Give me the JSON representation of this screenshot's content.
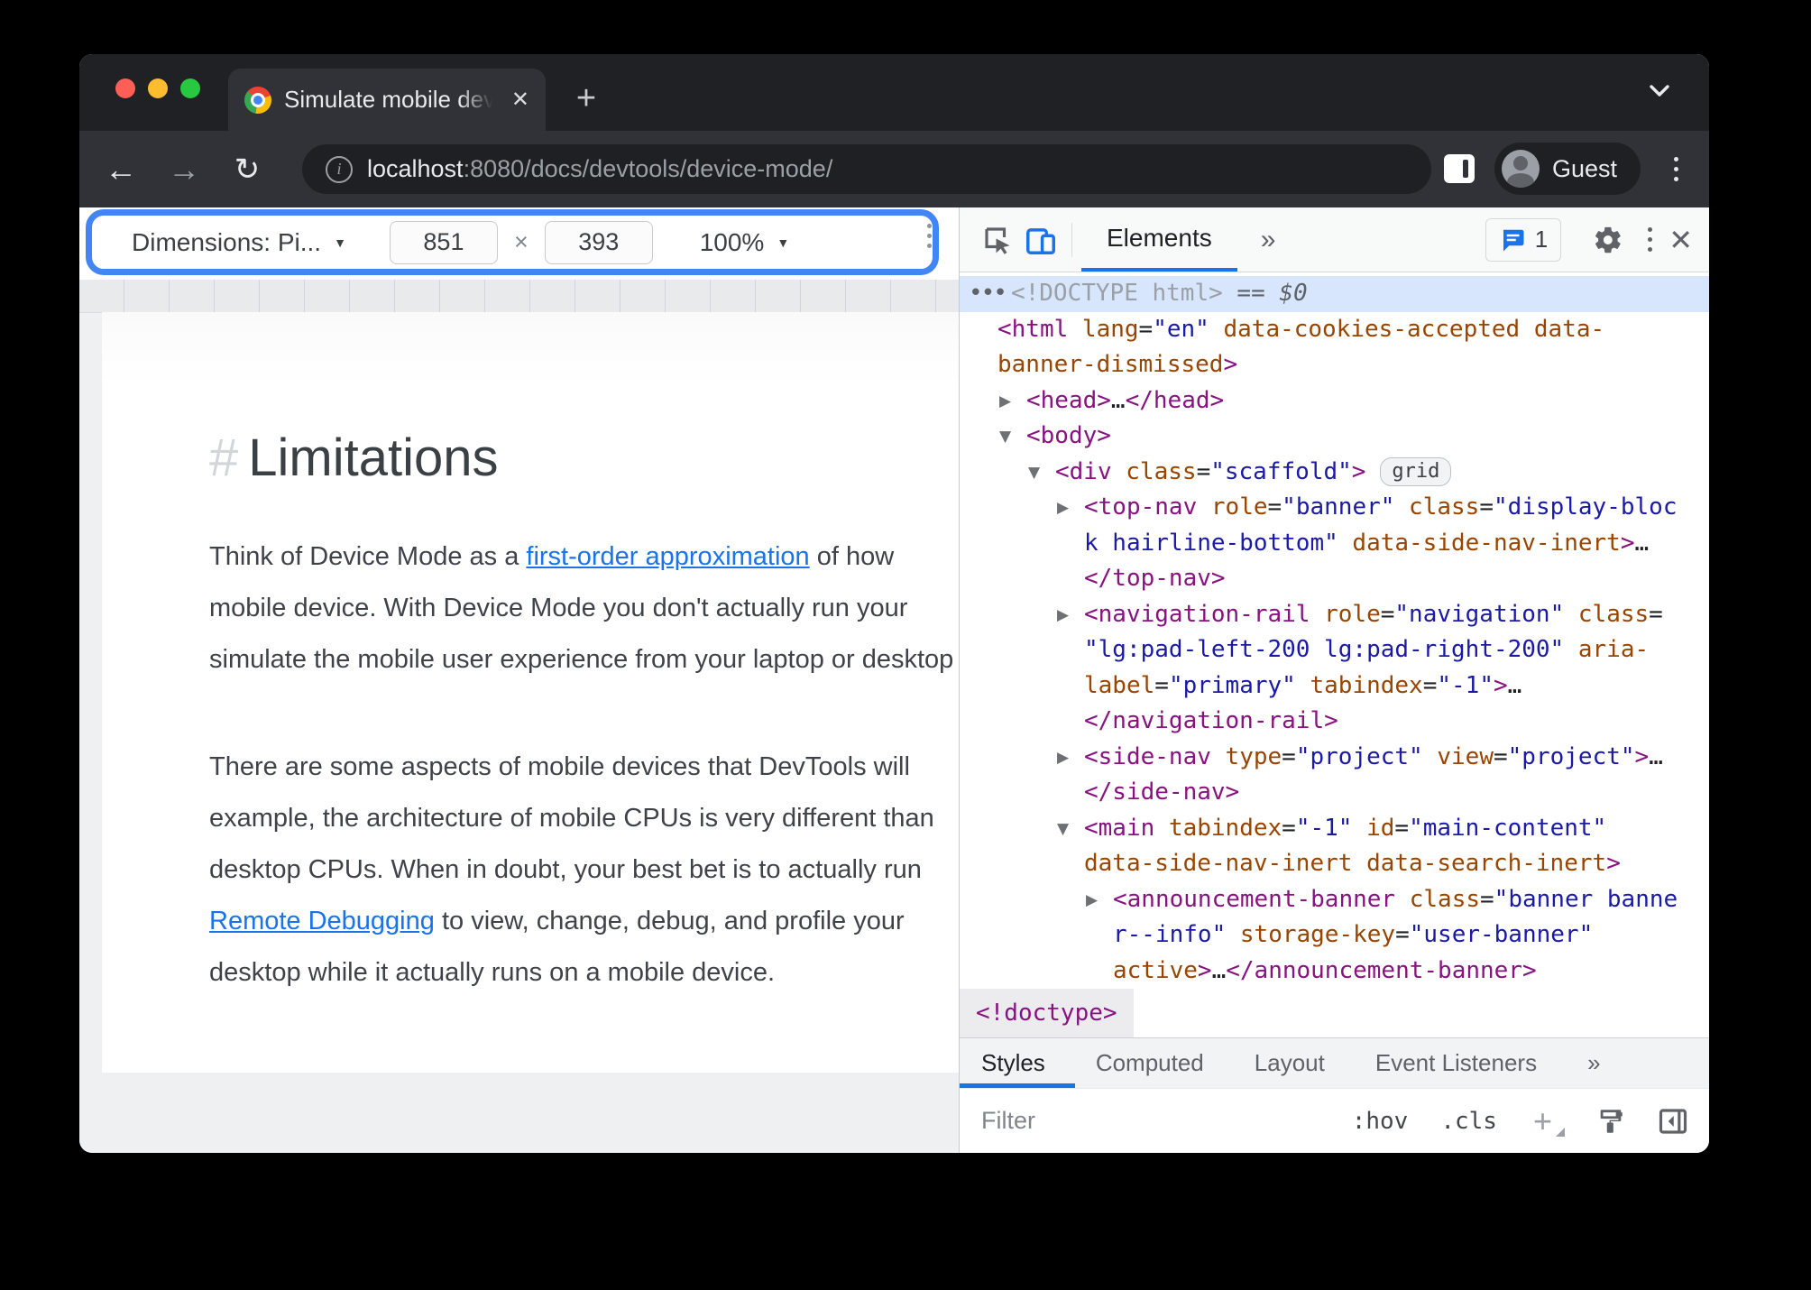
{
  "browser": {
    "tab_title": "Simulate mobile devices with D",
    "new_tab": "+",
    "close_tab": "✕",
    "back": "←",
    "forward": "→",
    "reload": "↻",
    "info": "i",
    "url_host": "localhost",
    "url_path": ":8080/docs/devtools/device-mode/",
    "profile_label": "Guest"
  },
  "device_toolbar": {
    "dimensions_label": "Dimensions: Pi...",
    "caret": "▼",
    "width_value": "851",
    "times": "×",
    "height_value": "393",
    "zoom_value": "100%"
  },
  "page": {
    "heading_hash": "#",
    "heading": "Limitations",
    "paragraphs": [
      {
        "gap": false,
        "lines": [
          [
            {
              "t": "Think of Device Mode as a "
            },
            {
              "t": "first-order approximation",
              "link": true
            },
            {
              "t": " of how"
            }
          ],
          [
            {
              "t": "mobile device. With Device Mode you don't actually run your"
            }
          ],
          [
            {
              "t": "simulate the mobile user experience from your laptop or desktop"
            }
          ]
        ]
      },
      {
        "gap": true,
        "lines": [
          [
            {
              "t": "There are some aspects of mobile devices that DevTools will"
            }
          ],
          [
            {
              "t": "example, the architecture of mobile CPUs is very different than"
            }
          ],
          [
            {
              "t": "desktop CPUs. When in doubt, your best bet is to actually run"
            }
          ],
          [
            {
              "t": "Remote Debugging",
              "link": true
            },
            {
              "t": " to view, change, debug, and profile your"
            }
          ],
          [
            {
              "t": "desktop while it actually runs on a mobile device."
            }
          ]
        ]
      }
    ]
  },
  "devtools": {
    "panel_tab": "Elements",
    "more_tabs": "»",
    "console_count": "1",
    "close": "✕",
    "breadcrumb": "<!doctype>",
    "sidebar_tabs": [
      {
        "label": "Styles",
        "active": true
      },
      {
        "label": "Computed",
        "active": false
      },
      {
        "label": "Layout",
        "active": false
      },
      {
        "label": "Event Listeners",
        "active": false
      },
      {
        "label": "»",
        "active": false
      }
    ],
    "filter_placeholder": "Filter",
    "hov": ":hov",
    "cls": ".cls",
    "plus": "+",
    "tree": [
      {
        "indent": 10,
        "selected": true,
        "arrow": null,
        "parts": [
          {
            "c": "pre",
            "t": "•••"
          },
          {
            "c": "dim",
            "t": "<!DOCTYPE html>"
          },
          {
            "c": "dollar",
            "t": " == "
          },
          {
            "c": "dollar",
            "t": "$0"
          }
        ]
      },
      {
        "indent": 42,
        "arrow": null,
        "parts": [
          {
            "c": "tag",
            "t": "<html "
          },
          {
            "c": "attr",
            "t": "lang"
          },
          {
            "c": "eq",
            "t": "="
          },
          {
            "c": "val",
            "t": "\"en\""
          },
          {
            "c": "attr",
            "t": " data-cookies-accepted data-"
          }
        ]
      },
      {
        "indent": 42,
        "arrow": null,
        "parts": [
          {
            "c": "attr",
            "t": "banner-dismissed"
          },
          {
            "c": "tag",
            "t": ">"
          }
        ]
      },
      {
        "indent": 74,
        "arrow": "closed",
        "parts": [
          {
            "c": "tag",
            "t": "<head>"
          },
          {
            "c": "dots",
            "t": "…"
          },
          {
            "c": "tag",
            "t": "</head>"
          }
        ]
      },
      {
        "indent": 74,
        "arrow": "open",
        "parts": [
          {
            "c": "tag",
            "t": "<body>"
          }
        ]
      },
      {
        "indent": 106,
        "arrow": "open",
        "parts": [
          {
            "c": "tag",
            "t": "<div "
          },
          {
            "c": "attr",
            "t": "class"
          },
          {
            "c": "eq",
            "t": "="
          },
          {
            "c": "val",
            "t": "\"scaffold\""
          },
          {
            "c": "tag",
            "t": ">"
          },
          {
            "c": "badge",
            "t": "grid"
          }
        ]
      },
      {
        "indent": 138,
        "arrow": "closed",
        "parts": [
          {
            "c": "tag",
            "t": "<top-nav "
          },
          {
            "c": "attr",
            "t": "role"
          },
          {
            "c": "eq",
            "t": "="
          },
          {
            "c": "val",
            "t": "\"banner\""
          },
          {
            "c": "attr",
            "t": " class"
          },
          {
            "c": "eq",
            "t": "="
          },
          {
            "c": "val",
            "t": "\"display-bloc"
          }
        ]
      },
      {
        "indent": 138,
        "arrow": null,
        "parts": [
          {
            "c": "val",
            "t": "k hairline-bottom\""
          },
          {
            "c": "attr",
            "t": " data-side-nav-inert"
          },
          {
            "c": "tag",
            "t": ">"
          },
          {
            "c": "dots",
            "t": "…"
          }
        ]
      },
      {
        "indent": 138,
        "arrow": null,
        "parts": [
          {
            "c": "tag",
            "t": "</top-nav>"
          }
        ]
      },
      {
        "indent": 138,
        "arrow": "closed",
        "parts": [
          {
            "c": "tag",
            "t": "<navigation-rail "
          },
          {
            "c": "attr",
            "t": "role"
          },
          {
            "c": "eq",
            "t": "="
          },
          {
            "c": "val",
            "t": "\"navigation\""
          },
          {
            "c": "attr",
            "t": " class"
          },
          {
            "c": "eq",
            "t": "="
          }
        ]
      },
      {
        "indent": 138,
        "arrow": null,
        "parts": [
          {
            "c": "val",
            "t": "\"lg:pad-left-200 lg:pad-right-200\""
          },
          {
            "c": "attr",
            "t": " aria-"
          }
        ]
      },
      {
        "indent": 138,
        "arrow": null,
        "parts": [
          {
            "c": "attr",
            "t": "label"
          },
          {
            "c": "eq",
            "t": "="
          },
          {
            "c": "val",
            "t": "\"primary\""
          },
          {
            "c": "attr",
            "t": " tabindex"
          },
          {
            "c": "eq",
            "t": "="
          },
          {
            "c": "val",
            "t": "\"-1\""
          },
          {
            "c": "tag",
            "t": ">"
          },
          {
            "c": "dots",
            "t": "…"
          }
        ]
      },
      {
        "indent": 138,
        "arrow": null,
        "parts": [
          {
            "c": "tag",
            "t": "</navigation-rail>"
          }
        ]
      },
      {
        "indent": 138,
        "arrow": "closed",
        "parts": [
          {
            "c": "tag",
            "t": "<side-nav "
          },
          {
            "c": "attr",
            "t": "type"
          },
          {
            "c": "eq",
            "t": "="
          },
          {
            "c": "val",
            "t": "\"project\""
          },
          {
            "c": "attr",
            "t": " view"
          },
          {
            "c": "eq",
            "t": "="
          },
          {
            "c": "val",
            "t": "\"project\""
          },
          {
            "c": "tag",
            "t": ">"
          },
          {
            "c": "dots",
            "t": "…"
          }
        ]
      },
      {
        "indent": 138,
        "arrow": null,
        "parts": [
          {
            "c": "tag",
            "t": "</side-nav>"
          }
        ]
      },
      {
        "indent": 138,
        "arrow": "open",
        "parts": [
          {
            "c": "tag",
            "t": "<main "
          },
          {
            "c": "attr",
            "t": "tabindex"
          },
          {
            "c": "eq",
            "t": "="
          },
          {
            "c": "val",
            "t": "\"-1\""
          },
          {
            "c": "attr",
            "t": " id"
          },
          {
            "c": "eq",
            "t": "="
          },
          {
            "c": "val",
            "t": "\"main-content\""
          }
        ]
      },
      {
        "indent": 138,
        "arrow": null,
        "parts": [
          {
            "c": "attr",
            "t": "data-side-nav-inert data-search-inert"
          },
          {
            "c": "tag",
            "t": ">"
          }
        ]
      },
      {
        "indent": 170,
        "arrow": "closed",
        "parts": [
          {
            "c": "tag",
            "t": "<announcement-banner "
          },
          {
            "c": "attr",
            "t": "class"
          },
          {
            "c": "eq",
            "t": "="
          },
          {
            "c": "val",
            "t": "\"banner banne"
          }
        ]
      },
      {
        "indent": 170,
        "arrow": null,
        "parts": [
          {
            "c": "val",
            "t": "r--info\""
          },
          {
            "c": "attr",
            "t": " storage-key"
          },
          {
            "c": "eq",
            "t": "="
          },
          {
            "c": "val",
            "t": "\"user-banner\""
          }
        ]
      },
      {
        "indent": 170,
        "arrow": null,
        "parts": [
          {
            "c": "attr",
            "t": "active"
          },
          {
            "c": "tag",
            "t": ">"
          },
          {
            "c": "dots",
            "t": "…"
          },
          {
            "c": "tag",
            "t": "</announcement-banner>"
          }
        ]
      }
    ]
  }
}
